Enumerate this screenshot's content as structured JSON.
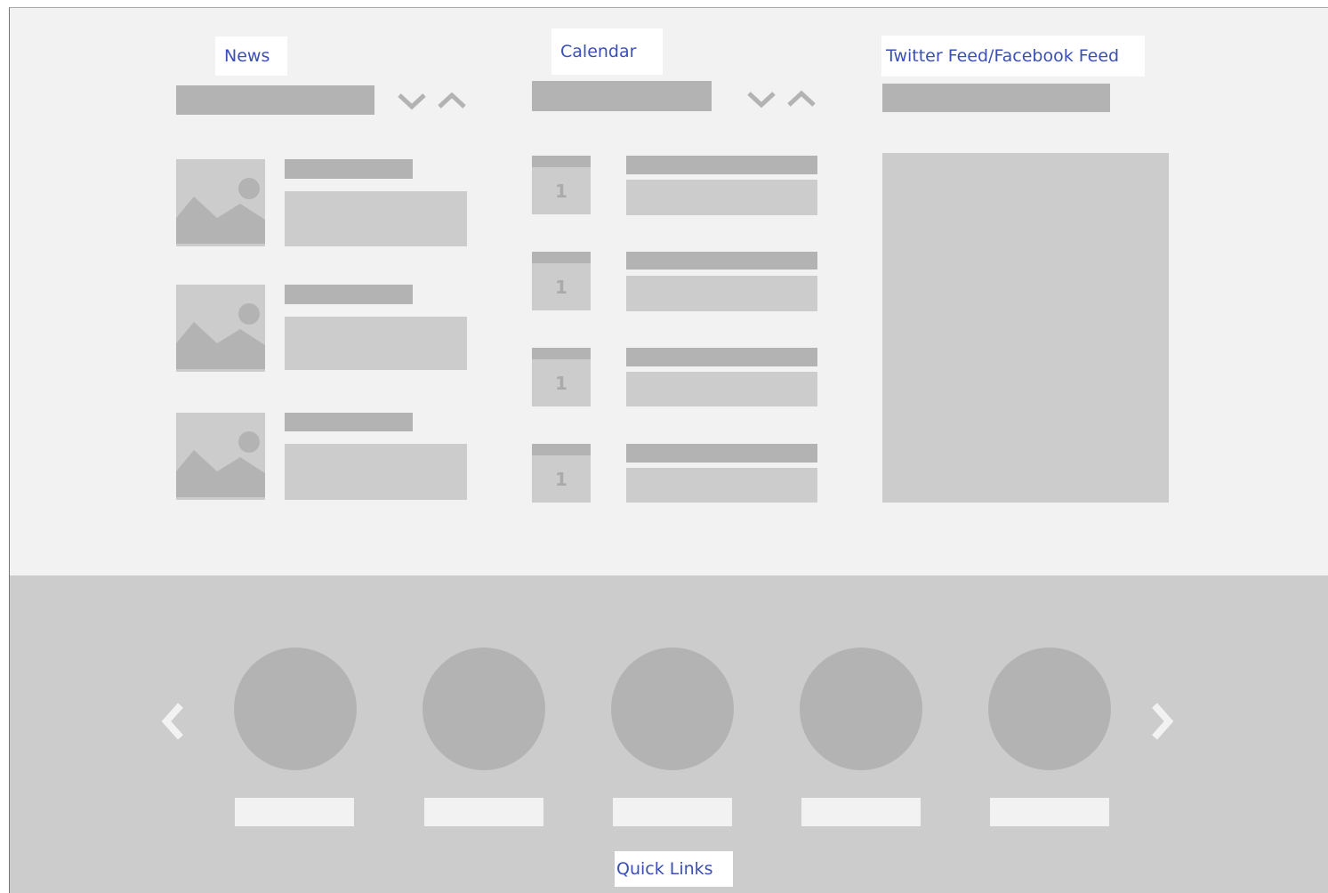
{
  "sections": {
    "news": {
      "title": "News"
    },
    "calendar": {
      "title": "Calendar",
      "days": [
        "1",
        "1",
        "1",
        "1"
      ]
    },
    "social": {
      "title": "Twitter Feed/Facebook Feed"
    },
    "quick_links": {
      "title": "Quick Links"
    }
  },
  "icons": {
    "prev": "chevron-left-icon",
    "next": "chevron-right-icon",
    "collapse": "chevron-down-icon",
    "expand": "chevron-up-icon",
    "thumbnail": "image-placeholder-icon",
    "calendar_day": "calendar-icon"
  },
  "colors": {
    "label_text": "#3a4fb7",
    "page_background": "#f2f2f2",
    "footer_background": "#cccccc",
    "placeholder_dark": "#b3b3b3",
    "placeholder_light": "#cccccc"
  }
}
